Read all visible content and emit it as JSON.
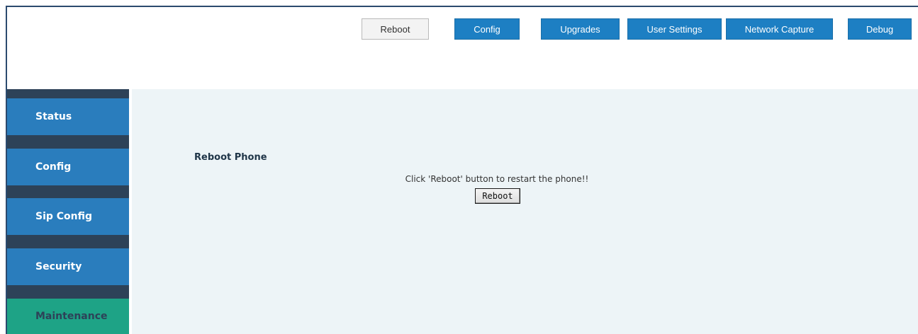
{
  "topnav": {
    "buttons": [
      {
        "label": "Reboot",
        "style": "light"
      },
      {
        "label": "Config",
        "style": "primary"
      },
      {
        "label": "Upgrades",
        "style": "primary"
      },
      {
        "label": "User Settings",
        "style": "primary"
      },
      {
        "label": "Network Capture",
        "style": "primary"
      },
      {
        "label": "Debug",
        "style": "primary"
      }
    ]
  },
  "sidebar": {
    "items": [
      {
        "label": "Status"
      },
      {
        "label": "Config"
      },
      {
        "label": "Sip Config"
      },
      {
        "label": "Security"
      },
      {
        "label": "Maintenance",
        "active": true
      }
    ]
  },
  "main": {
    "title": "Reboot Phone",
    "message": "Click 'Reboot' button to restart the phone!!",
    "button_label": "Reboot"
  },
  "colors": {
    "primary_button": "#1d7fc3",
    "sidebar_item": "#2a7dbd",
    "sidebar_active": "#1ea386",
    "sidebar_bg": "#2d4258",
    "main_bg": "#edf4f7"
  }
}
